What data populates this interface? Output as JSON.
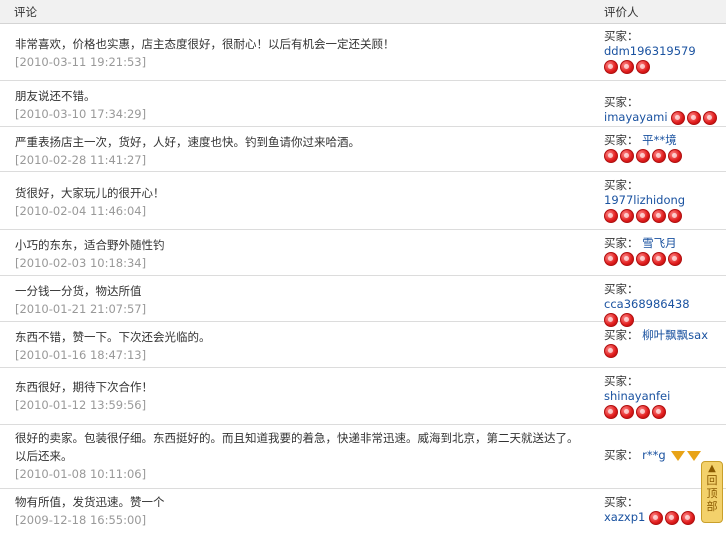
{
  "header": {
    "col_comment": "评论",
    "col_reviewer": "评价人"
  },
  "reviews": [
    {
      "text": "非常喜欢，价格也实惠，店主态度很好，很耐心！以后有机会一定还关顾！",
      "date": "[2010-03-11 19:21:53]",
      "buyer_label": "买家：",
      "buyer_name": "ddm196319579",
      "hearts": 3
    },
    {
      "text": "朋友说还不错。",
      "date": "[2010-03-10 17:34:29]",
      "buyer_label": "买家：",
      "buyer_name": "imayayami",
      "hearts": 3
    },
    {
      "text": "严重表扬店主一次，货好，人好，速度也快。钓到鱼请你过来哈酒。",
      "date": "[2010-02-28 11:41:27]",
      "buyer_label": "买家：",
      "buyer_name": "平**境",
      "hearts": 5
    },
    {
      "text": "货很好，大家玩儿的很开心！",
      "date": "[2010-02-04 11:46:04]",
      "buyer_label": "买家：",
      "buyer_name": "1977lizhidong",
      "hearts": 5
    },
    {
      "text": "小巧的东东，适合野外随性钓",
      "date": "[2010-02-03 10:18:34]",
      "buyer_label": "买家：",
      "buyer_name": "雪飞月",
      "hearts": 5
    },
    {
      "text": "一分钱一分货，物达所值",
      "date": "[2010-01-21 21:07:57]",
      "buyer_label": "买家：",
      "buyer_name": "cca368986438",
      "hearts": 2
    },
    {
      "text": "东西不错，赞一下。下次还会光临的。",
      "date": "[2010-01-16 18:47:13]",
      "buyer_label": "买家：",
      "buyer_name": "柳叶飘飘sax",
      "hearts": 1
    },
    {
      "text": "东西很好，期待下次合作！",
      "date": "[2010-01-12 13:59:56]",
      "buyer_label": "买家：",
      "buyer_name": "shinayanfei",
      "hearts": 4
    },
    {
      "text": "很好的卖家。包装很仔细。东西挺好的。而且知道我要的着急，快递非常迅速。威海到北京，第二天就送达了。以后还来。",
      "date": "[2010-01-08 10:11:06]",
      "buyer_label": "买家：",
      "buyer_name": "r**g",
      "hearts": 0,
      "diamonds": 2
    },
    {
      "text": "物有所值，发货迅速。赞一个",
      "date": "[2009-12-18 16:55:00]",
      "buyer_label": "买家：",
      "buyer_name": "xazxp1",
      "hearts": 3
    }
  ],
  "back_to_top": {
    "label": "回顶部"
  }
}
